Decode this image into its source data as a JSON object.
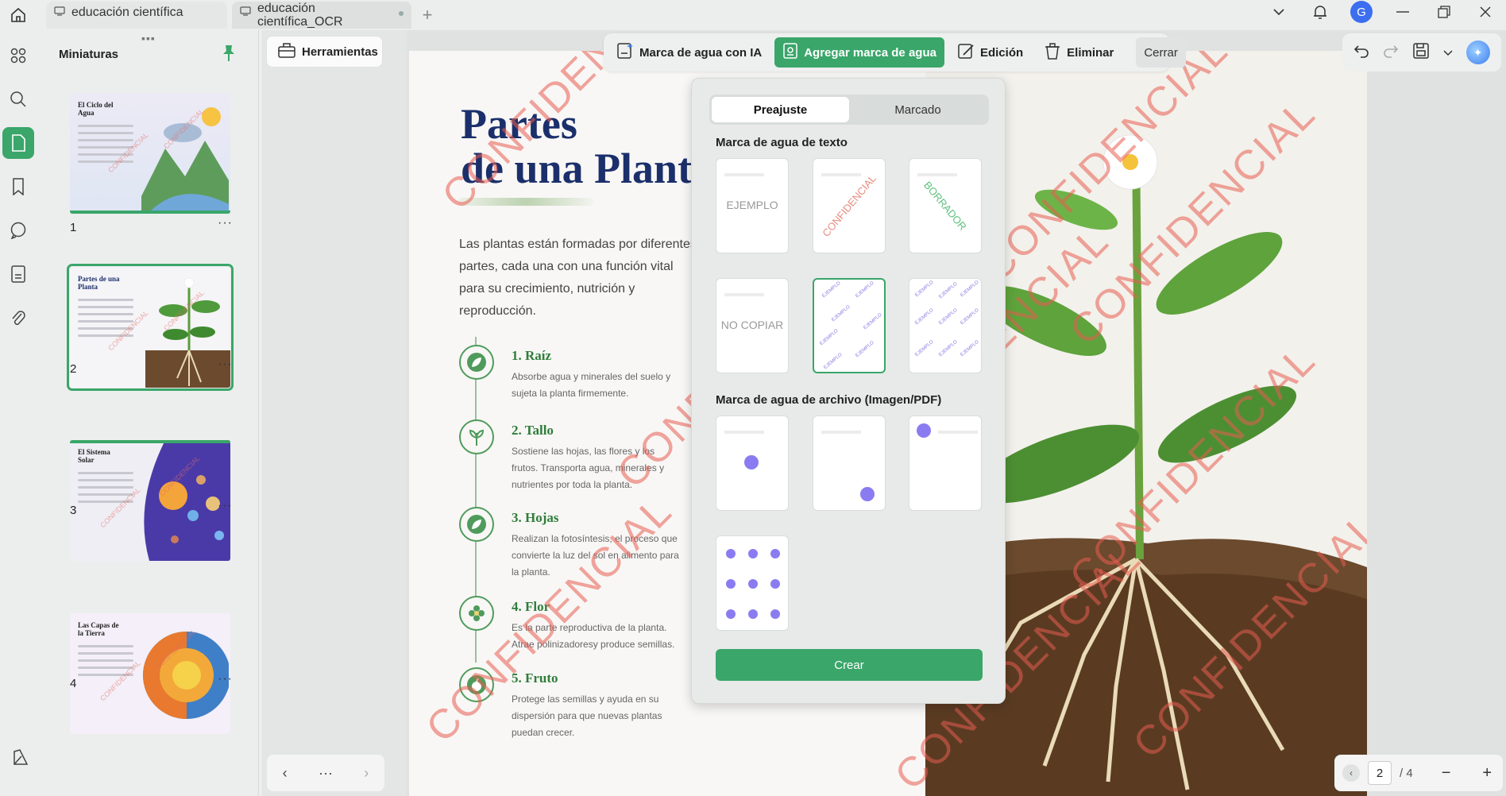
{
  "tabs": [
    {
      "label": "educación científica"
    },
    {
      "label": "educación científica_OCR"
    }
  ],
  "user": {
    "initial": "G"
  },
  "thumbnails": {
    "title": "Miniaturas",
    "pages": [
      {
        "number": "1",
        "title": "El Ciclo del Agua"
      },
      {
        "number": "2",
        "title": "Partes de una Planta"
      },
      {
        "number": "3",
        "title": "El Sistema Solar"
      },
      {
        "number": "4",
        "title": "Las Capas de la Tierra"
      }
    ]
  },
  "tools": {
    "label": "Herramientas",
    "pager_dots": "···"
  },
  "watermark_toolbar": {
    "ai": "Marca de agua con IA",
    "add": "Agregar marca de agua",
    "edit": "Edición",
    "delete": "Eliminar",
    "close": "Cerrar"
  },
  "panel": {
    "tabs": [
      "Preajuste",
      "Marcado"
    ],
    "text_section": "Marca de agua de texto",
    "file_section": "Marca de agua de archivo (Imagen/PDF)",
    "presets": [
      "EJEMPLO",
      "CONFIDENCIAL",
      "BORRADOR",
      "NO COPIAR",
      "EJEMPLO",
      "EJEMPLO"
    ],
    "create": "Crear"
  },
  "document": {
    "title_line1": "Partes",
    "title_line2": "de una Planta",
    "intro": "Las plantas están formadas por diferentes partes, cada una con una función vital para su crecimiento, nutrición y reproducción.",
    "watermark": "CONFIDENCIAL",
    "items": [
      {
        "title": "1. Raíz",
        "desc": "Absorbe agua y minerales del suelo y sujeta la planta firmemente."
      },
      {
        "title": "2. Tallo",
        "desc": "Sostiene las hojas, las flores y los frutos. Transporta agua, minerales y nutrientes por toda la planta."
      },
      {
        "title": "3. Hojas",
        "desc": "Realizan la fotosíntesis, el proceso que convierte la luz del sol en alimento para la planta."
      },
      {
        "title": "4. Flor",
        "desc": "Es la parte reproductiva de la planta. Atrae polinizadoresy produce semillas."
      },
      {
        "title": "5. Fruto",
        "desc": "Protege las semillas y ayuda en su dispersión para que nuevas plantas puedan crecer."
      }
    ]
  },
  "pagination": {
    "current": "2",
    "total": "/ 4"
  },
  "colors": {
    "accent": "#3aa66a",
    "watermark": "#e85c50",
    "title": "#1b2f6b"
  }
}
